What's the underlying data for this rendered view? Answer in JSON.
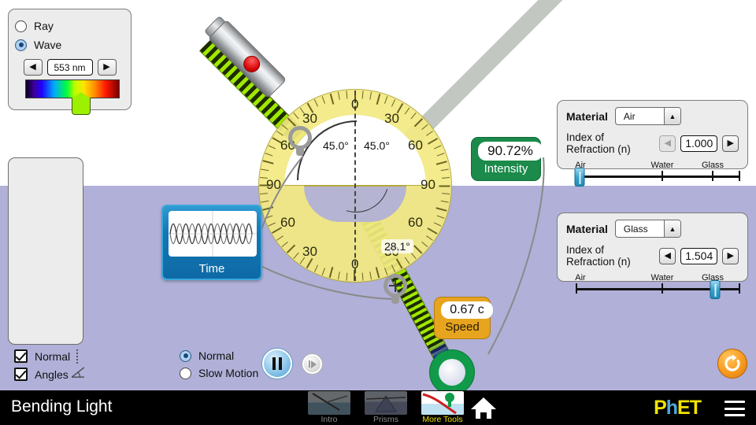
{
  "app": {
    "title": "Bending Light",
    "sim_name": "PhET"
  },
  "wavelength_panel": {
    "ray_label": "Ray",
    "wave_label": "Wave",
    "selected": "Wave",
    "wavelength_value": "553 nm",
    "decrement_label": "◀",
    "increment_label": "▶",
    "spectrum_thumb_color": "#9cf000"
  },
  "protractor": {
    "incident_angle": "45.0°",
    "reflected_angle": "45.0°",
    "refracted_angle": "28.1°",
    "scale_labels_top": [
      "30",
      "0",
      "30"
    ],
    "scale_labels_mid": [
      "60",
      "60"
    ],
    "scale_labels_side": [
      "90",
      "90"
    ],
    "scale_labels_lowmid": [
      "60",
      "60"
    ],
    "scale_labels_bottom": [
      "30",
      "0",
      "30"
    ]
  },
  "readouts": {
    "intensity": {
      "value": "90.72%",
      "caption": "Intensity",
      "color": "#1b8a4a"
    },
    "speed": {
      "value": "0.67 c",
      "caption": "Speed",
      "color": "#e7a41f"
    }
  },
  "time_chart": {
    "label": "Time"
  },
  "materials": {
    "top": {
      "material_label": "Material",
      "material_value": "Air",
      "index_label": "Index of Refraction (n)",
      "index_value": "1.000",
      "decrement_label": "◀",
      "increment_label": "▶",
      "ticks": [
        "Air",
        "Water",
        "Glass"
      ],
      "thumb_percent": 1
    },
    "bottom": {
      "material_label": "Material",
      "material_value": "Glass",
      "index_label": "Index of Refraction (n)",
      "index_value": "1.504",
      "decrement_label": "◀",
      "increment_label": "▶",
      "ticks": [
        "Air",
        "Water",
        "Glass"
      ],
      "thumb_percent": 81
    }
  },
  "view_options": {
    "normal_label": "Normal",
    "normal_checked": true,
    "angles_label": "Angles",
    "angles_checked": true
  },
  "speed_options": {
    "normal_label": "Normal",
    "slow_motion_label": "Slow Motion",
    "selected": "Normal"
  },
  "playback": {
    "pause_name": "pause",
    "step_name": "step-forward"
  },
  "reset": {
    "label": "reset-all"
  },
  "navbar": {
    "title": "Bending Light",
    "tabs": [
      {
        "label": "Intro",
        "active": false
      },
      {
        "label": "Prisms",
        "active": false
      },
      {
        "label": "More Tools",
        "active": true
      }
    ],
    "home_icon": "home-icon",
    "menu_icon": "hamburger-icon",
    "logo_text_1": "P",
    "logo_text_2": "h",
    "logo_text_3": "ET"
  },
  "colors": {
    "sky": "#ffffff",
    "glass": "#b0b0d8",
    "protractor": "#f3ea84",
    "laser_beam": "#9fe800",
    "reflected_beam": "#c3c7c1",
    "accent_blue": "#3ba2cd",
    "nav_active": "#f2e300"
  }
}
